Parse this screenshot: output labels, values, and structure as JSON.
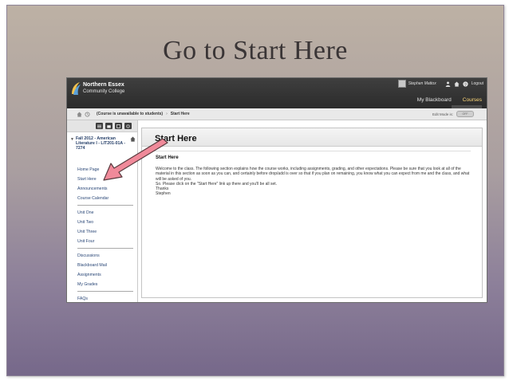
{
  "slide": {
    "title": "Go to Start Here"
  },
  "header": {
    "logo_line1": "Northern Essex",
    "logo_line2": "Community College",
    "user_name": "Stephen Mattox",
    "logout_label": "Logout",
    "tabs": [
      "My Blackboard",
      "Courses"
    ]
  },
  "breadcrumb": {
    "course": "(Course is unavailable to students)",
    "page": "Start Here",
    "edit_mode_label": "Edit Mode is:",
    "edit_mode_value": "OFF"
  },
  "sidebar": {
    "course_title": "Fall 2012 - American Literature I - LIT201-01A - 7274",
    "groups": [
      [
        "Home Page",
        "Start Here",
        "Announcements",
        "Course Calendar"
      ],
      [
        "Unit One",
        "Unit Two",
        "Unit Three",
        "Unit Four"
      ],
      [
        "Discussions",
        "Blackboard Mail",
        "Assignments",
        "My Grades"
      ],
      [
        "FAQs"
      ]
    ]
  },
  "content": {
    "page_title": "Start Here",
    "item_title": "Start Here",
    "paragraph": "Welcome to the class. The following section explains how the course works, including assignments, grading, and other expectations. Please be sure that you look at all of the material in this section as soon as you can, and certainly before drop/add is over so that if you plan on remaining, you know what you can expect from me and the class, and what will be asked of you.",
    "line2": "So. Please click on the \"Start Here\" link up there and you'll be all set.",
    "line3": "Thanks",
    "line4": "Stephen"
  },
  "colors": {
    "accent_tab": "#ffd97a",
    "link": "#2a4777",
    "arrow": "#f08a9a"
  }
}
